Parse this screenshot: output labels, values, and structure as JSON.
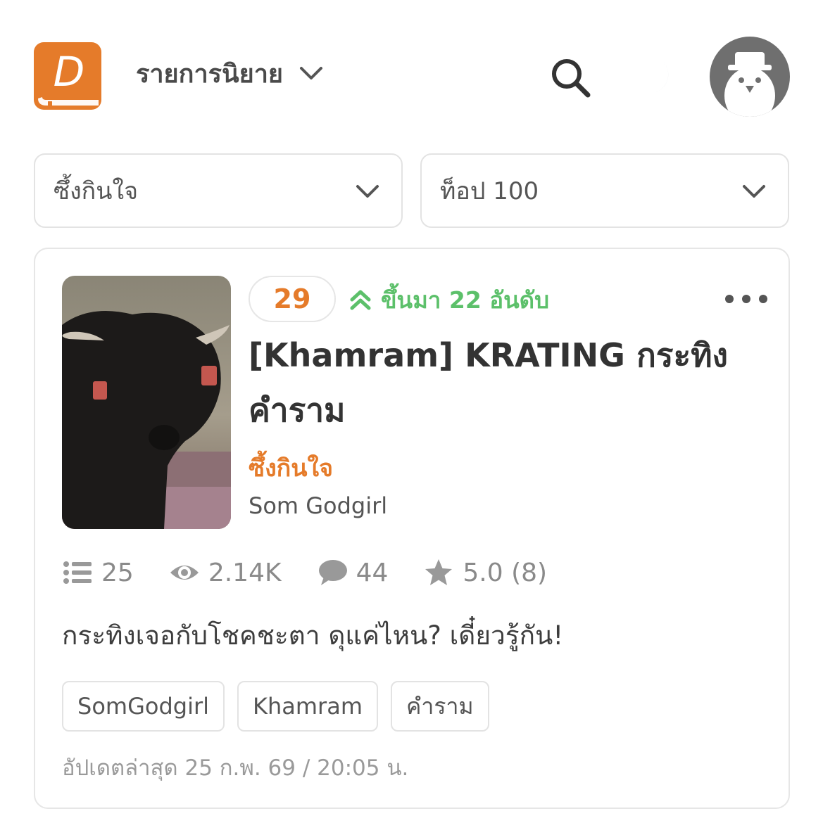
{
  "header": {
    "nav_title": "รายการนิยาย",
    "logo_letter": "D"
  },
  "filters": [
    {
      "value": "ซึ้งกินใจ"
    },
    {
      "value": "ท็อป 100"
    }
  ],
  "novel": {
    "rank": "29",
    "rank_change": "ขึ้นมา 22 อันดับ",
    "title": "[Khamram] KRATING กระทิงคำราม",
    "category": "ซึ้งกินใจ",
    "author": "Som Godgirl",
    "stats": {
      "chapters": "25",
      "views": "2.14K",
      "comments": "44",
      "rating": "5.0 (8)"
    },
    "description": "กระทิงเจอกับโชคชะตา ดุแค่ไหน? เดี๋ยวรู้กัน!",
    "tags": [
      "SomGodgirl",
      "Khamram",
      "คำราม"
    ],
    "updated": "อัปเดตล่าสุด 25 ก.พ. 69 / 20:05 น."
  },
  "colors": {
    "brand": "#e57b2a",
    "rank_up": "#5cc06a",
    "moon": "#1f3a5c"
  },
  "icons": [
    "logo-icon",
    "chevron-down-icon",
    "search-icon",
    "moon-icon",
    "avatar-icon",
    "double-chevron-up-icon",
    "more-icon",
    "list-icon",
    "eye-icon",
    "comment-icon",
    "star-icon"
  ]
}
